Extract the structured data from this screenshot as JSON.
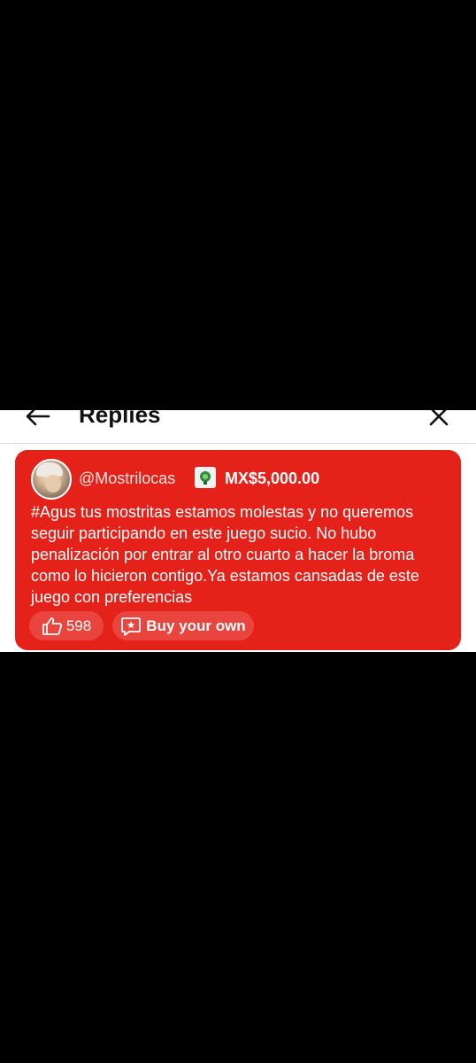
{
  "header": {
    "title": "Replies",
    "back_icon": "arrow-left-icon",
    "close_icon": "close-icon"
  },
  "reply": {
    "username": "@Mostrilocas",
    "gift_icon": "gift-badge-icon",
    "amount": "MX$5,000.00",
    "message": "#Agus tus mostritas estamos molestas y no queremos seguir participando en este juego sucio. No hubo penalización por entrar al otro cuarto a hacer la broma como lo hicieron contigo.Ya estamos cansadas de este juego con preferencias",
    "likes": "598",
    "like_icon": "thumbs-up-icon",
    "buy_label": "Buy your own",
    "buy_icon": "super-chat-icon",
    "card_color": "#e5221a"
  }
}
